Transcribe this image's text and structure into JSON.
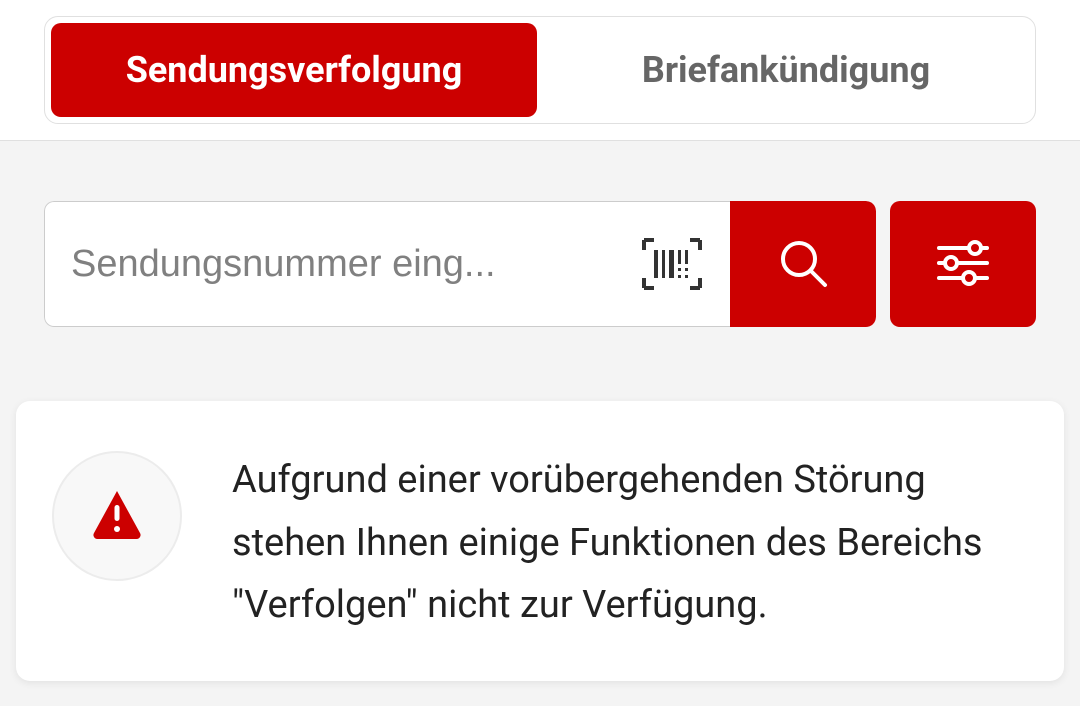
{
  "tabs": {
    "tracking": "Sendungsverfolgung",
    "letterNotification": "Briefankündigung"
  },
  "search": {
    "placeholder": "Sendungsnummer eing..."
  },
  "alert": {
    "message": "Aufgrund einer vorübergehenden Störung stehen Ihnen einige Funktionen des Bereichs \"Verfolgen\" nicht zur Verfügung."
  },
  "colors": {
    "brand": "#cc0000"
  }
}
